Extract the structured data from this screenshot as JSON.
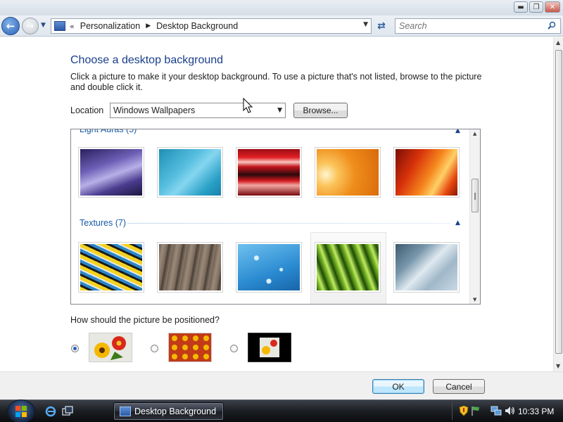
{
  "window": {
    "caption_buttons": [
      "minimize",
      "maximize",
      "close"
    ]
  },
  "navigation": {
    "address_chevron": "«",
    "breadcrumb": [
      "Personalization",
      "Desktop Background"
    ],
    "search_placeholder": "Search"
  },
  "page": {
    "heading": "Choose a desktop background",
    "description": "Click a picture to make it your desktop background. To use a picture that's not listed, browse to the picture and double click it.",
    "location_label": "Location",
    "location_value": "Windows Wallpapers",
    "browse_label": "Browse...",
    "position_question": "How should the picture be positioned?"
  },
  "gallery": {
    "groups": [
      {
        "name": "Light Auras (5)",
        "items": [
          "aura-purple",
          "aura-teal",
          "aura-red-stripes",
          "aura-orange-glow",
          "aura-orange-red"
        ]
      },
      {
        "name": "Textures (7)",
        "items": [
          "fish-school",
          "wood-planks",
          "water-drops",
          "green-leaves",
          "glass-drops"
        ]
      }
    ]
  },
  "positions": {
    "options": [
      "fit-to-screen",
      "tile",
      "center"
    ],
    "selected": "fit-to-screen"
  },
  "footer": {
    "ok_label": "OK",
    "cancel_label": "Cancel"
  },
  "taskbar": {
    "task_label": "Desktop Background",
    "clock": "10:33 PM"
  },
  "colors": {
    "heading": "#1a3e8a",
    "group_header": "#1a5aa6",
    "radio_selected": "#2a62bd"
  }
}
